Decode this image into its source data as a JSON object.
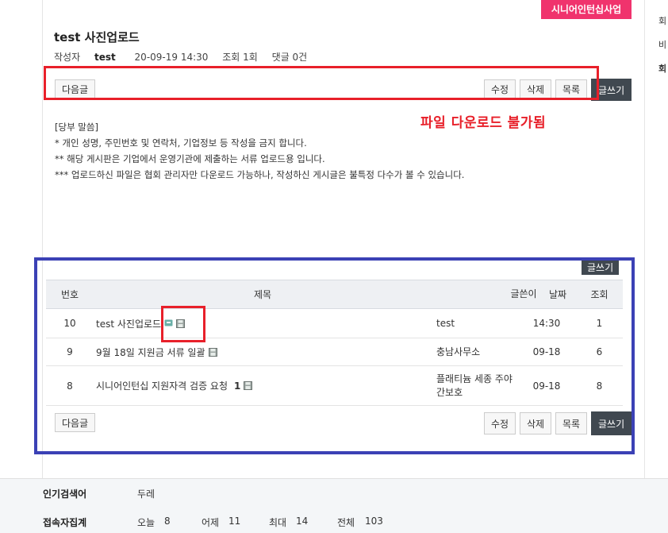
{
  "category_badge": "시니어인턴십사업",
  "post": {
    "title": "test 사진업로드",
    "author_label": "작성자",
    "author": "test",
    "datetime": "20-09-19 14:30",
    "views": "조회 1회",
    "comments": "댓글 0건"
  },
  "buttons": {
    "next": "다음글",
    "edit": "수정",
    "delete": "삭제",
    "list": "목록",
    "write": "글쓰기"
  },
  "annotation_text": "파일 다운로드 불가됨",
  "notice": [
    "[당부 말씀]",
    "* 개인 성명, 주민번호 및 연락처, 기업정보 등 작성을 금지 합니다.",
    "** 해당 게시판은 기업에서 운영기관에 제출하는 서류 업로드용 입니다.",
    "*** 업로드하신 파일은 협회 관리자만 다운로드 가능하나, 작성하신 게시글은 불특정 다수가 볼 수 있습니다."
  ],
  "table": {
    "headers": [
      "번호",
      "제목",
      "글쓴이",
      "날짜",
      "조회"
    ],
    "rows": [
      {
        "num": "10",
        "title": "test 사진업로드",
        "comment_count": "",
        "writer": "test",
        "date": "14:30",
        "views": "1"
      },
      {
        "num": "9",
        "title": "9월 18일 지원금 서류 일괄",
        "comment_count": "",
        "writer": "충남사무소",
        "date": "09-18",
        "views": "6"
      },
      {
        "num": "8",
        "title": "시니어인턴십 지원자격 검증 요청",
        "comment_count": "1",
        "writer": "플래티늄 세종 주야간보호",
        "date": "09-18",
        "views": "8"
      }
    ]
  },
  "footer": {
    "popular_label": "인기검색어",
    "popular_value": "두레",
    "visitors_label": "접속자집계",
    "today_label": "오늘",
    "today": "8",
    "yesterday_label": "어제",
    "yesterday": "11",
    "max_label": "최대",
    "max": "14",
    "total_label": "전체",
    "total": "103"
  },
  "sidebar_fragments": [
    "회",
    "비",
    "회"
  ],
  "colors": {
    "accent_pink": "#f0336d",
    "annotation_red": "#e8202a",
    "annotation_blue": "#3b41b5",
    "dark_button": "#404850"
  },
  "icons": {
    "comment": "comment-icon",
    "file": "floppy-disk-icon"
  }
}
